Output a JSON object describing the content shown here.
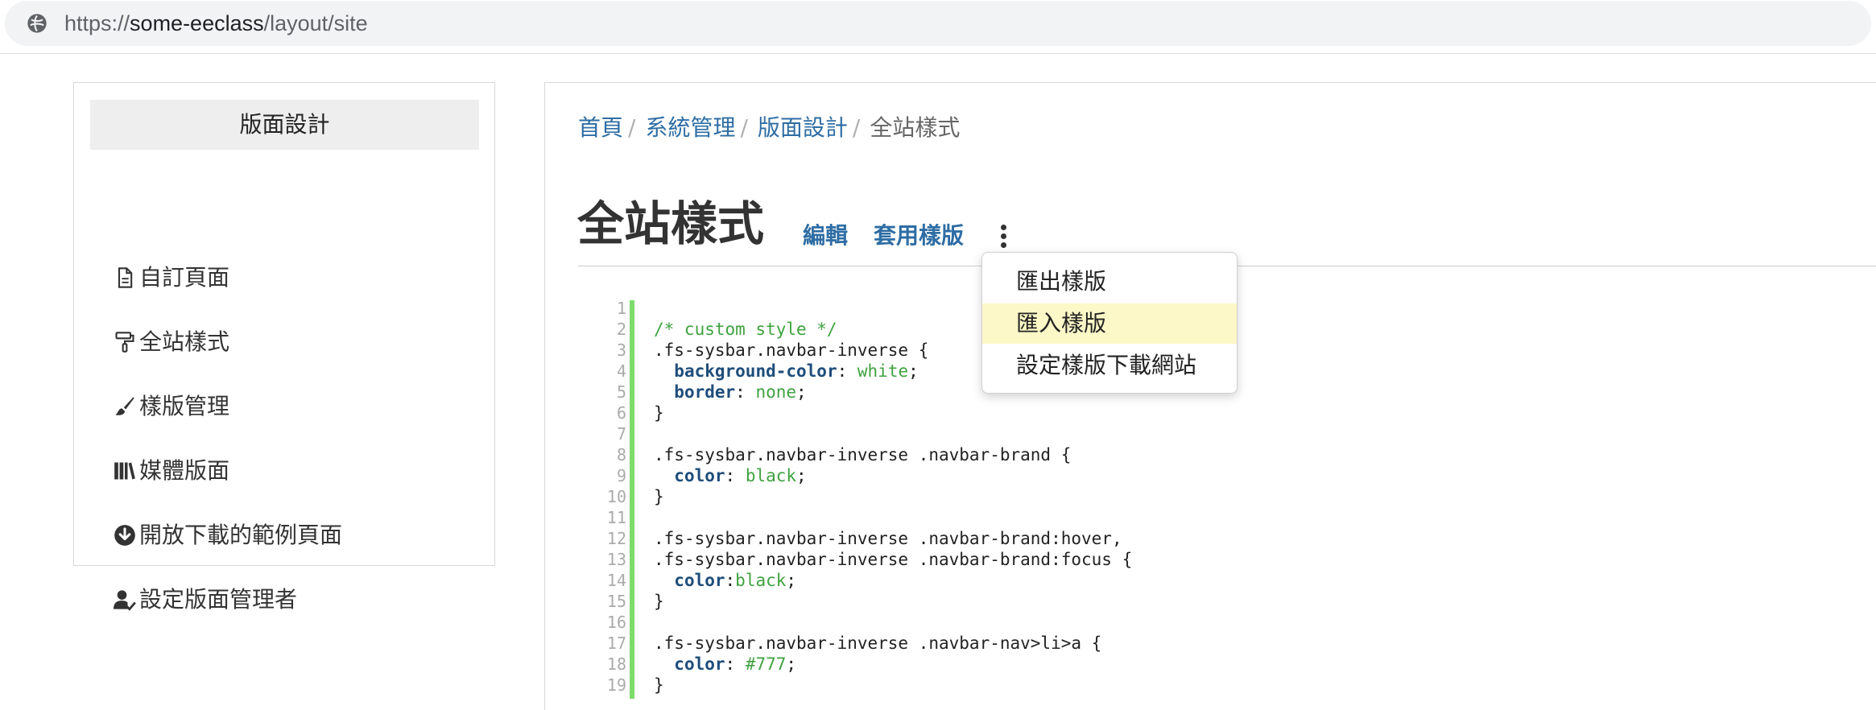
{
  "browser": {
    "url_scheme": "https://",
    "url_host": "some-eeclass",
    "url_path": "/layout/site"
  },
  "sidebar": {
    "title": "版面設計",
    "items": [
      {
        "label": "自訂頁面",
        "icon": "file-icon"
      },
      {
        "label": "全站樣式",
        "icon": "paint-roller-icon"
      },
      {
        "label": "樣版管理",
        "icon": "paint-brush-icon"
      },
      {
        "label": "媒體版面",
        "icon": "books-icon"
      },
      {
        "label": "開放下載的範例頁面",
        "icon": "download-circle-icon"
      },
      {
        "label": "設定版面管理者",
        "icon": "user-check-icon"
      }
    ]
  },
  "breadcrumb": {
    "items": [
      "首頁",
      "系統管理",
      "版面設計"
    ],
    "current": "全站樣式",
    "separator": "/"
  },
  "page": {
    "title": "全站樣式",
    "actions": {
      "edit": "編輯",
      "apply_template": "套用樣版"
    }
  },
  "dropdown": {
    "items": [
      {
        "label": "匯出樣版",
        "highlighted": false
      },
      {
        "label": "匯入樣版",
        "highlighted": true
      },
      {
        "label": "設定樣版下載網站",
        "highlighted": false
      }
    ]
  },
  "editor": {
    "line_numbers": [
      "1",
      "2",
      "3",
      "4",
      "5",
      "6",
      "7",
      "8",
      "9",
      "10",
      "11",
      "12",
      "13",
      "14",
      "15",
      "16",
      "17",
      "18",
      "19"
    ],
    "lines": [
      "",
      "/* custom style */",
      ".fs-sysbar.navbar-inverse {",
      "  background-color: white;",
      "  border: none;",
      "}",
      "",
      ".fs-sysbar.navbar-inverse .navbar-brand {",
      "  color: black;",
      "}",
      "",
      ".fs-sysbar.navbar-inverse .navbar-brand:hover,",
      ".fs-sysbar.navbar-inverse .navbar-brand:focus {",
      "  color:black;",
      "}",
      "",
      ".fs-sysbar.navbar-inverse .navbar-nav>li>a {",
      "  color: #777;",
      "}"
    ]
  },
  "colors": {
    "link": "#2e6da4",
    "gutter_bar": "#7ddc6b",
    "highlight": "#fcf8c7",
    "css_property": "#1e4d7b",
    "css_value_comment": "#3fa23f"
  }
}
